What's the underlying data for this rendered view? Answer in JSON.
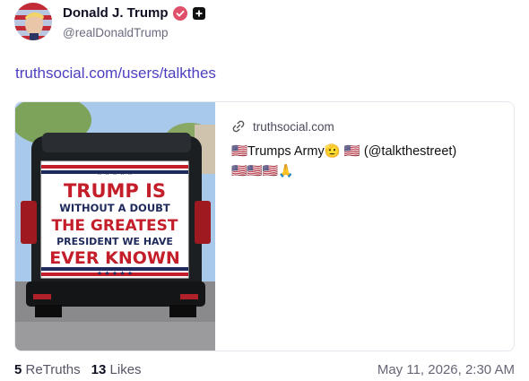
{
  "author": {
    "display_name": "Donald J. Trump",
    "handle": "@realDonaldTrump",
    "verified": true
  },
  "post": {
    "link_text": "truthsocial.com/users/talkthes"
  },
  "card": {
    "domain": "truthsocial.com",
    "title": "🇺🇸Trumps Army🫡 🇺🇸 (@talkthestreet)",
    "description": "🇺🇸🇺🇸🇺🇸🙏",
    "image_sign": {
      "line1": "TRUMP IS",
      "line2": "WITHOUT A DOUBT",
      "line3": "THE GREATEST",
      "line4": "PRESIDENT WE HAVE",
      "line5": "EVER KNOWN"
    }
  },
  "stats": {
    "retruths_count": "5",
    "retruths_label": "ReTruths",
    "likes_count": "13",
    "likes_label": "Likes"
  },
  "timestamp": "May 11, 2026, 2:30 AM",
  "colors": {
    "link": "#4b3fc0",
    "verified_badge": "#e0506a",
    "sign_red": "#c41e2a",
    "sign_navy": "#1f2a5c"
  }
}
